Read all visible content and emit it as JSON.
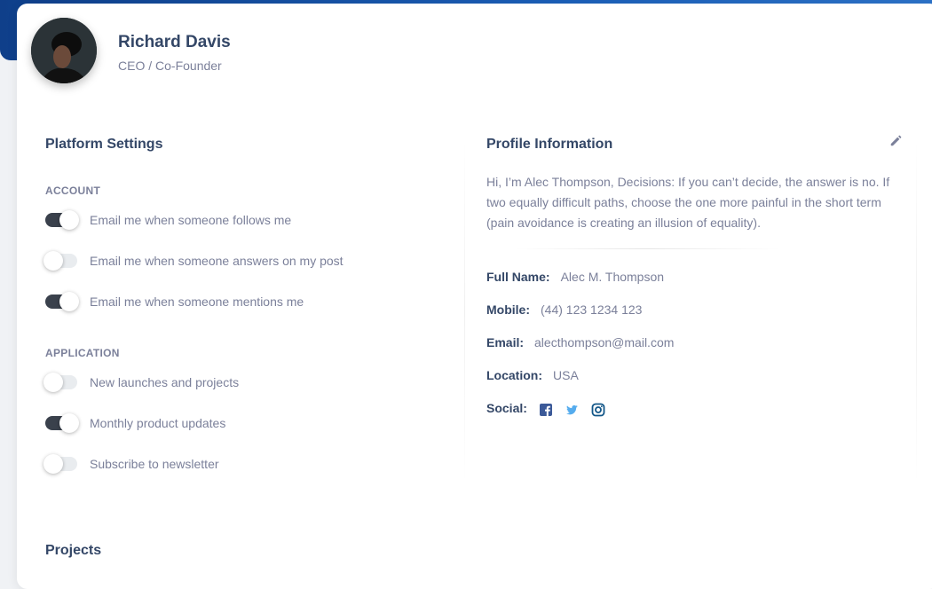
{
  "profile": {
    "name": "Richard Davis",
    "role": "CEO / Co-Founder"
  },
  "platform_settings": {
    "title": "Platform Settings",
    "account_label": "ACCOUNT",
    "account_items": [
      {
        "label": "Email me when someone follows me",
        "enabled": true
      },
      {
        "label": "Email me when someone answers on my post",
        "enabled": false
      },
      {
        "label": "Email me when someone mentions me",
        "enabled": true
      }
    ],
    "application_label": "APPLICATION",
    "application_items": [
      {
        "label": "New launches and projects",
        "enabled": false
      },
      {
        "label": "Monthly product updates",
        "enabled": true
      },
      {
        "label": "Subscribe to newsletter",
        "enabled": false
      }
    ]
  },
  "profile_information": {
    "title": "Profile Information",
    "bio": "Hi, I’m Alec Thompson, Decisions: If you can’t decide, the answer is no. If two equally difficult paths, choose the one more painful in the short term (pain avoidance is creating an illusion of equality).",
    "full_name_label": "Full Name:",
    "full_name": "Alec M. Thompson",
    "mobile_label": "Mobile:",
    "mobile": "(44) 123 1234 123",
    "email_label": "Email:",
    "email": "alecthompson@mail.com",
    "location_label": "Location:",
    "location": "USA",
    "social_label": "Social:",
    "social_icons": [
      "facebook-icon",
      "twitter-icon",
      "instagram-icon"
    ]
  },
  "projects": {
    "title": "Projects"
  },
  "colors": {
    "banner": "#1b5fb8",
    "heading": "#344767",
    "muted": "#7b809a",
    "toggle_on": "#3a414c",
    "facebook": "#3b5998",
    "twitter": "#55acee",
    "instagram": "#125688"
  }
}
